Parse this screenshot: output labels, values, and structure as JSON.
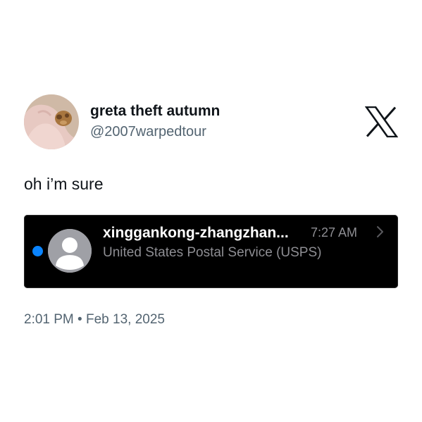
{
  "author": {
    "display_name": "greta theft autumn",
    "handle": "@2007warpedtour",
    "avatar_icon": "profile-photo"
  },
  "platform_icon": "x-logo-icon",
  "tweet": {
    "text": "oh i’m sure",
    "timestamp": "2:01 PM",
    "separator": "•",
    "date": "Feb 13, 2025"
  },
  "embedded_message": {
    "sender": "xinggankong-zhangzhan...",
    "time": "7:27 AM",
    "preview": "United States Postal Service (USPS)",
    "unread": true,
    "contact_icon": "person-silhouette-icon",
    "chevron_icon": "chevron-right-icon"
  },
  "colors": {
    "text": "#0f1419",
    "secondary_text": "#536471",
    "unread_dot": "#0a84ff",
    "card_background": "#000000",
    "card_secondary_text": "#8e8e93"
  }
}
